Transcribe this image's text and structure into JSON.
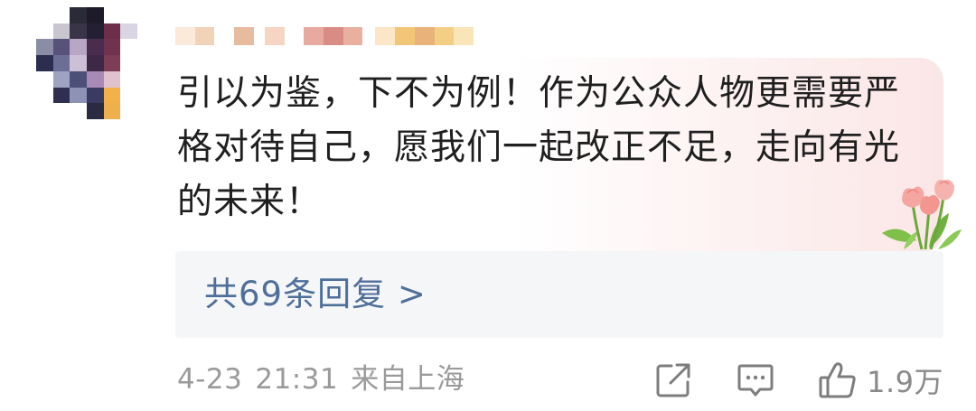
{
  "comment": {
    "text": "引以为鉴，下不为例！作为公众人物更需要严格对待自己，愿我们一起改正不足，走向有光的未来！"
  },
  "replies": {
    "label": "共69条回复 >"
  },
  "meta": {
    "date": "4-23",
    "time": "21:31",
    "location": "来自上海"
  },
  "actions": {
    "share_icon": "share-icon",
    "comment_icon": "comment-icon",
    "like_icon": "thumbs-up-icon",
    "like_count": "1.9万"
  },
  "colors": {
    "link": "#4e6f9a",
    "meta": "#9a9a9a",
    "text": "#1f1f1f",
    "replies_bg": "#f5f6f8"
  }
}
